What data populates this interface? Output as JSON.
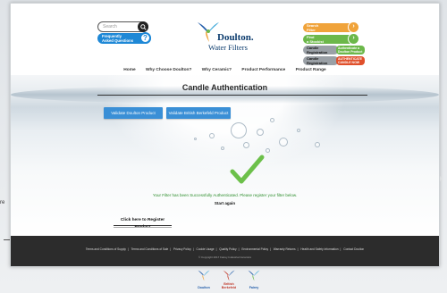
{
  "side": {
    "text": "re"
  },
  "header": {
    "search_placeholder": "Search",
    "faq_label_1": "Frequently",
    "faq_label_2": "Asked Questions",
    "faq_icon": "?",
    "logo_name": "Doulton.",
    "logo_sub": "Water Filters",
    "ctas": [
      {
        "label": "Search",
        "sub": "Filter",
        "color": "#f0a33a",
        "icon": "›"
      },
      {
        "label": "Find",
        "sub": "a Stockist",
        "color": "#6cb84a",
        "icon": "›"
      },
      {
        "label": "Candle",
        "sub": "Registration",
        "color": "#9aa0a6",
        "badge": "Authenticate a Doulton Product",
        "badge_color": "#6cb84a"
      },
      {
        "label": "Candle",
        "sub": "Registration",
        "color": "#9aa0a6",
        "badge": "AUTHENTICATE CANDLE NOW",
        "badge_color": "#e0502b"
      }
    ]
  },
  "nav": {
    "items": [
      "Home",
      "Why Choose Doulton?",
      "Why Ceramic?",
      "Product Performance",
      "Product Range"
    ]
  },
  "main": {
    "title": "Candle Authentication",
    "buttons": [
      "Validate Doulton Product",
      "Validate British Berkefeld Product"
    ],
    "success_text": "Your Filter has been Successfully Authenticated. Please register your filter below.",
    "start_again": "Start again",
    "register_label": "Click here to Register Product"
  },
  "footer": {
    "links": [
      "Terms and Conditions of Supply",
      "Terms and Conditions of Sale",
      "Privacy Policy",
      "Cookie Usage",
      "Quality Policy",
      "Environmental Policy",
      "Warranty Returns",
      "Health and Safety Information",
      "Contact Doulton"
    ],
    "copyright": "© Copyright 2017 Fairey Industrial Ceramics"
  },
  "brands": [
    {
      "name": "Doulton",
      "color": "#1e5aa8"
    },
    {
      "name": "British Berkefeld",
      "color": "#c0392b"
    },
    {
      "name": "Fairey",
      "color": "#1e5aa8"
    }
  ],
  "colors": {
    "primary_button": "#3a8fd6",
    "success_green": "#6cc04a",
    "footer_bg": "#2c2c2c"
  }
}
